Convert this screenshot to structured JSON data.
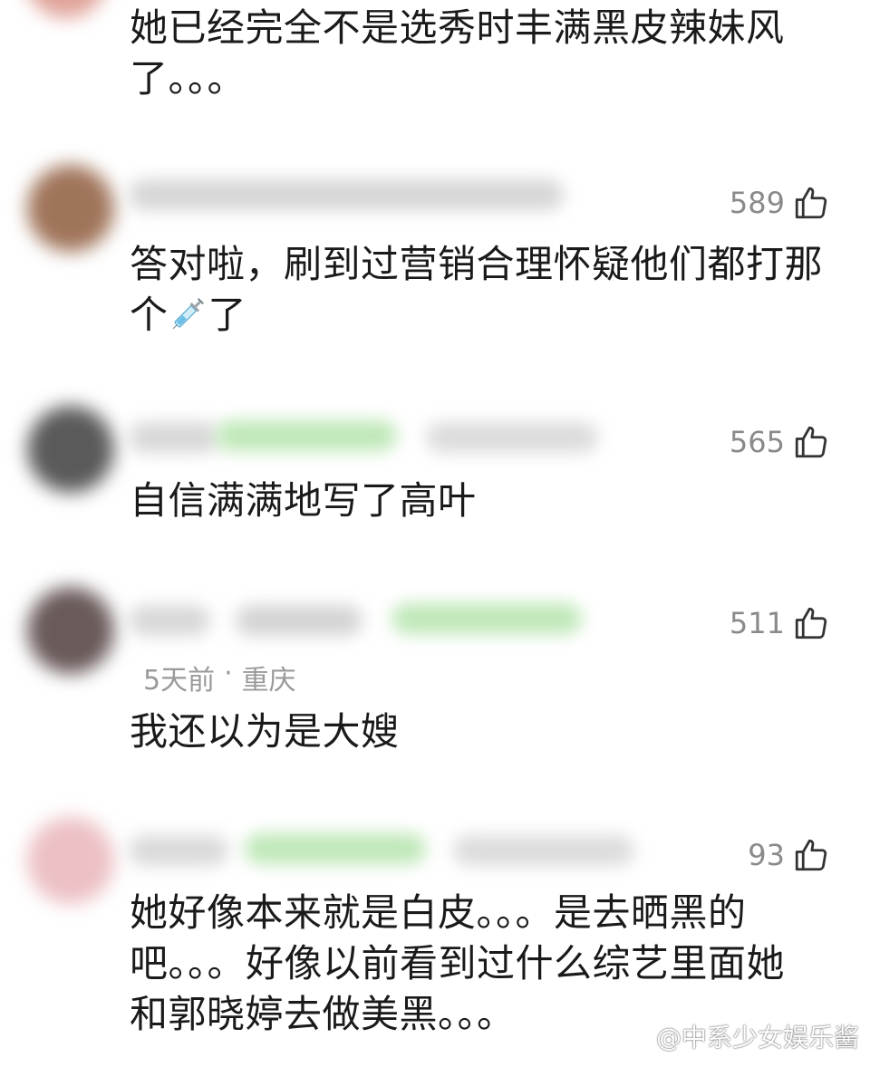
{
  "comments": [
    {
      "text": "她已经完全不是选秀时丰满黑皮辣妹风\n了。。。",
      "avatar_color": "#e0a39a"
    },
    {
      "likes": "589",
      "text_before": "答对啦，刷到过营销合理怀疑他们都打那\n个",
      "emoji": "syringe-emoji",
      "text_after": "了",
      "avatar_color": "#a0745a"
    },
    {
      "likes": "565",
      "text": "自信满满地写了高叶",
      "avatar_color": "#5a5a5a"
    },
    {
      "likes": "511",
      "time": "5天前",
      "separator": "·",
      "location": "重庆",
      "text": "我还以为是大嫂",
      "avatar_color": "#6a5a5a"
    },
    {
      "likes": "93",
      "text": "她好像本来就是白皮。。。是去晒黑的\n吧。。。好像以前看到过什么综艺里面她\n和郭晓婷去做美黑。。。",
      "avatar_color": "#ecc0c4"
    }
  ],
  "like_icon": "thumbs-up-icon",
  "colors": {
    "text": "#1a1a1a",
    "meta": "#9a9a9a",
    "like_count": "#8a8a8a",
    "blur_name": "#d8d8d8",
    "blur_green": "#bfe8b8"
  },
  "watermark": {
    "icon": "weibo-logo",
    "text": "@中系少女娱乐酱"
  }
}
